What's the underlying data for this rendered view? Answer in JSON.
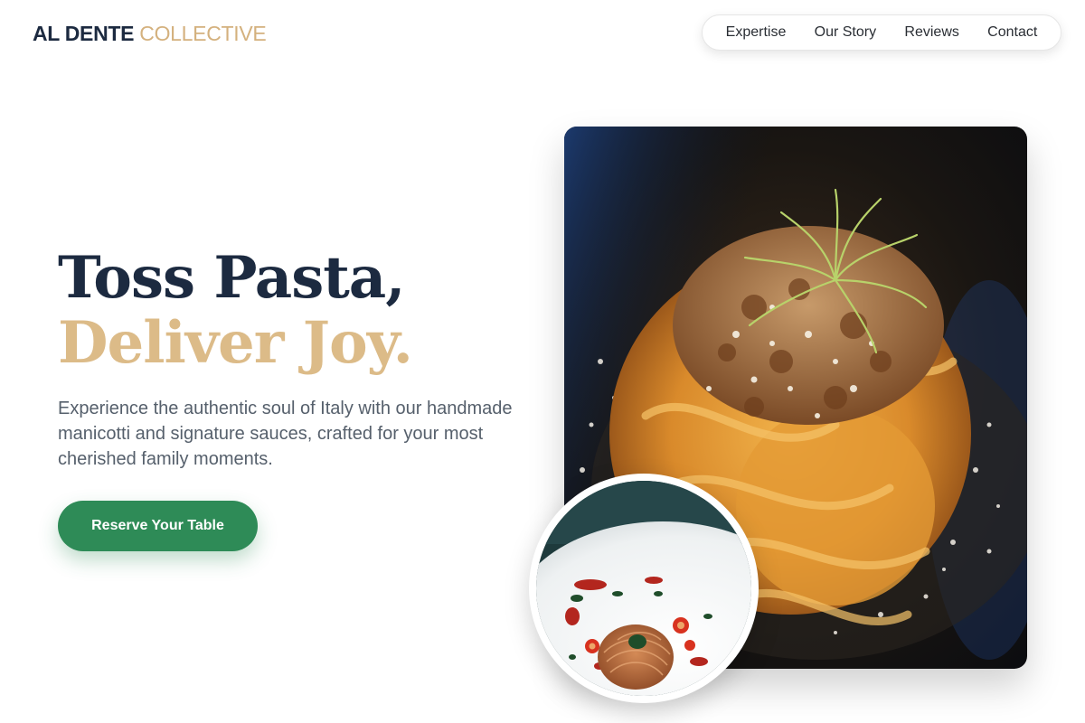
{
  "brand": {
    "name_primary": "AL DENTE",
    "name_secondary": "COLLECTIVE"
  },
  "nav": {
    "items": [
      {
        "label": "Expertise"
      },
      {
        "label": "Our Story"
      },
      {
        "label": "Reviews"
      },
      {
        "label": "Contact"
      }
    ]
  },
  "hero": {
    "headline_line1": "Toss Pasta,",
    "headline_line2": "Deliver Joy.",
    "subtitle": "Experience the authentic soul of Italy with our handmade manicotti and signature sauces, crafted for your most cherished family moments.",
    "cta_label": "Reserve Your Table"
  },
  "images": {
    "main": "tagliatelle-bolognese-photo",
    "secondary": "spaghetti-tomato-plate-photo"
  },
  "colors": {
    "navy": "#1c2a40",
    "gold": "#dcbb88",
    "green": "#2e8b57",
    "body_text": "#56606c"
  }
}
